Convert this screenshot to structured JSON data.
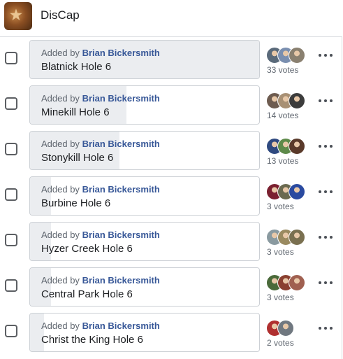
{
  "header": {
    "group_name": "DisCap",
    "group_icon": "group-photo-icon"
  },
  "options": [
    {
      "added_prefix": "Added by",
      "author": "Brian Bickersmith",
      "title": "Blatnick Hole 6",
      "votes": "33 votes",
      "share": 1.0,
      "avatars": [
        "#5a6a7a",
        "#7a8fb0",
        "#8a8070"
      ]
    },
    {
      "added_prefix": "Added by",
      "author": "Brian Bickersmith",
      "title": "Minekill Hole 6",
      "votes": "14 votes",
      "share": 0.42,
      "avatars": [
        "#6e5c50",
        "#a89074",
        "#3c3c3c"
      ]
    },
    {
      "added_prefix": "Added by",
      "author": "Brian Bickersmith",
      "title": "Stonykill Hole 6",
      "votes": "13 votes",
      "share": 0.39,
      "avatars": [
        "#2f4a80",
        "#5e8a4a",
        "#5a3a2a"
      ]
    },
    {
      "added_prefix": "Added by",
      "author": "Brian Bickersmith",
      "title": "Burbine Hole 6",
      "votes": "3 votes",
      "share": 0.09,
      "avatars": [
        "#7a2030",
        "#6a6a50",
        "#2a4aa0"
      ]
    },
    {
      "added_prefix": "Added by",
      "author": "Brian Bickersmith",
      "title": "Hyzer Creek Hole 6",
      "votes": "3 votes",
      "share": 0.09,
      "avatars": [
        "#8a9aa0",
        "#9a8a60",
        "#7a7050"
      ]
    },
    {
      "added_prefix": "Added by",
      "author": "Brian Bickersmith",
      "title": "Central Park Hole 6",
      "votes": "3 votes",
      "share": 0.09,
      "avatars": [
        "#4a6a3a",
        "#8a4030",
        "#a06050"
      ]
    },
    {
      "added_prefix": "Added by",
      "author": "Brian Bickersmith",
      "title": "Christ the King Hole 6",
      "votes": "2 votes",
      "share": 0.06,
      "avatars": [
        "#b03030",
        "#707880"
      ]
    }
  ]
}
